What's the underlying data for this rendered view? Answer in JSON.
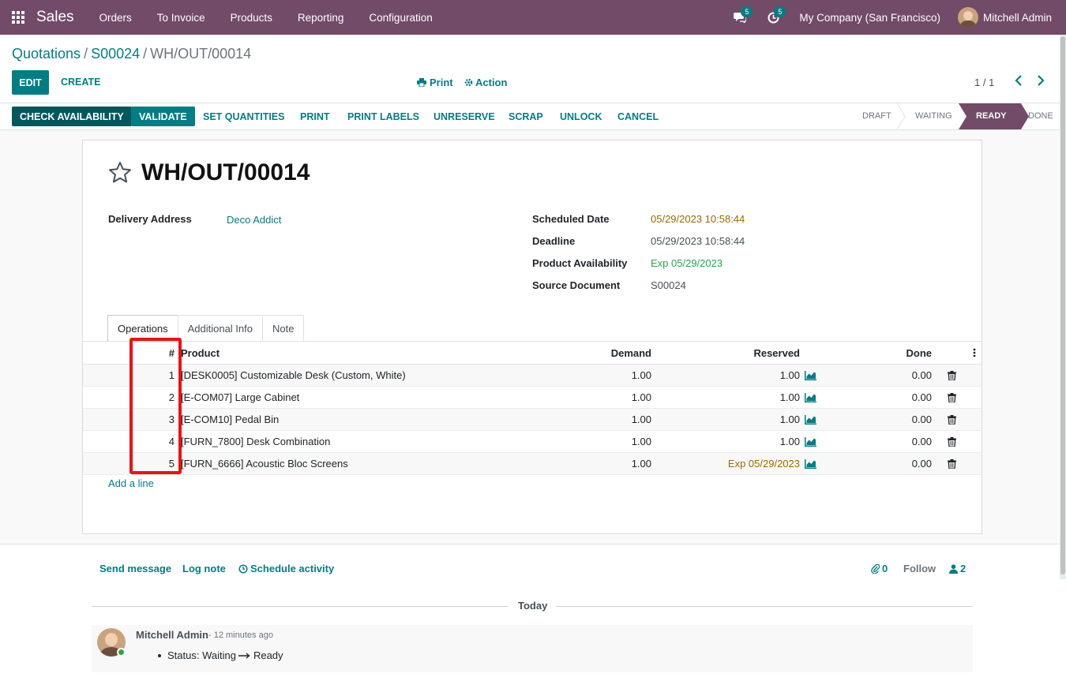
{
  "navbar": {
    "brand": "Sales",
    "menu": [
      "Orders",
      "To Invoice",
      "Products",
      "Reporting",
      "Configuration"
    ],
    "messages_count": "5",
    "activities_count": "5",
    "company": "My Company (San Francisco)",
    "user": "Mitchell Admin"
  },
  "breadcrumb": {
    "items": [
      "Quotations",
      "S00024"
    ],
    "current": "WH/OUT/00014"
  },
  "control": {
    "edit": "EDIT",
    "create": "CREATE",
    "print": "Print",
    "action": "Action",
    "pager": "1 / 1"
  },
  "statusbar": {
    "buttons": [
      "CHECK AVAILABILITY",
      "VALIDATE",
      "SET QUANTITIES",
      "PRINT",
      "PRINT LABELS",
      "UNRESERVE",
      "SCRAP",
      "UNLOCK",
      "CANCEL"
    ],
    "stages": [
      "DRAFT",
      "WAITING",
      "READY",
      "DONE"
    ],
    "active_stage": "READY"
  },
  "record": {
    "title": "WH/OUT/00014",
    "delivery_address_label": "Delivery Address",
    "delivery_address": "Deco Addict",
    "scheduled_date_label": "Scheduled Date",
    "scheduled_date": "05/29/2023 10:58:44",
    "deadline_label": "Deadline",
    "deadline": "05/29/2023 10:58:44",
    "availability_label": "Product Availability",
    "availability": "Exp 05/29/2023",
    "source_label": "Source Document",
    "source": "S00024"
  },
  "tabs": [
    "Operations",
    "Additional Info",
    "Note"
  ],
  "table": {
    "headers": {
      "num": "#",
      "product": "Product",
      "demand": "Demand",
      "reserved": "Reserved",
      "done": "Done"
    },
    "rows": [
      {
        "num": "1",
        "product": "[DESK0005] Customizable Desk (Custom, White)",
        "demand": "1.00",
        "reserved": "1.00",
        "done": "0.00"
      },
      {
        "num": "2",
        "product": "[E-COM07] Large Cabinet",
        "demand": "1.00",
        "reserved": "1.00",
        "done": "0.00"
      },
      {
        "num": "3",
        "product": "[E-COM10] Pedal Bin",
        "demand": "1.00",
        "reserved": "1.00",
        "done": "0.00"
      },
      {
        "num": "4",
        "product": "[FURN_7800] Desk Combination",
        "demand": "1.00",
        "reserved": "1.00",
        "done": "0.00"
      },
      {
        "num": "5",
        "product": "[FURN_6666] Acoustic Bloc Screens",
        "demand": "1.00",
        "reserved": "Exp 05/29/2023",
        "done": "0.00"
      }
    ],
    "add_line": "Add a line"
  },
  "chatter": {
    "send_message": "Send message",
    "log_note": "Log note",
    "schedule_activity": "Schedule activity",
    "attachments": "0",
    "follow": "Follow",
    "followers": "2",
    "today": "Today",
    "message": {
      "author": "Mitchell Admin",
      "time": "- 12 minutes ago",
      "status_from": "Status: Waiting",
      "status_to": "Ready"
    }
  },
  "colors": {
    "brand": "#714b67",
    "accent": "#017e84",
    "highlight": "#ee1111"
  }
}
